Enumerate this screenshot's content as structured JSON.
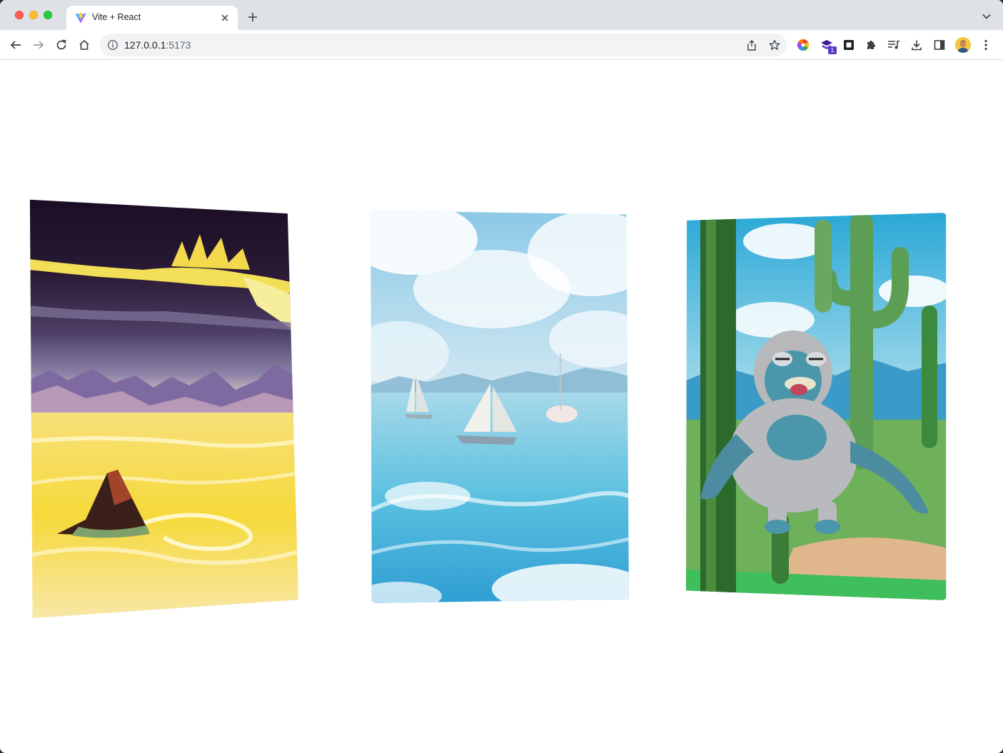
{
  "browser": {
    "tab": {
      "title": "Vite + React",
      "favicon": "vite-icon"
    },
    "address": {
      "host": "127.0.0.1",
      "port": ":5173"
    },
    "toolbar_icons": [
      "back-icon",
      "forward-icon",
      "reload-icon",
      "home-icon"
    ],
    "omnibox_icons": [
      "site-info-icon",
      "share-icon",
      "bookmark-star-icon"
    ],
    "extensions": [
      "color-wheel-extension-icon",
      "stack-extension-icon",
      "square-extension-icon",
      "puzzle-extensions-icon",
      "reading-list-icon",
      "download-icon",
      "side-panel-icon",
      "profile-avatar",
      "more-menu-icon"
    ],
    "extension_badge": "1"
  },
  "cards": [
    {
      "name": "desert-sunset-card",
      "subject": "yellow dunes with dark rock under a stormy sky"
    },
    {
      "name": "sailboats-sea-card",
      "subject": "sailboats on a blue sea with clouds"
    },
    {
      "name": "cactus-monster-card",
      "subject": "grey and blue monster among cacti"
    }
  ],
  "colors": {
    "tabstrip": "#dee1e6",
    "omnibox": "#f1f3f4",
    "accent": "#5b3bc4"
  }
}
